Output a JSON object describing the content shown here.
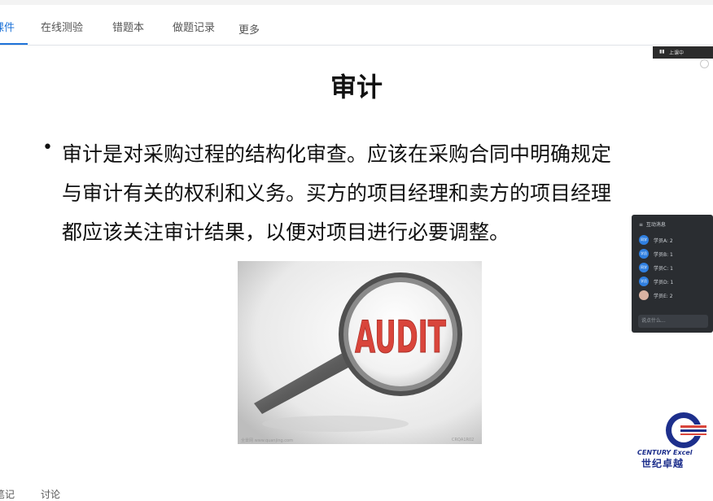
{
  "tabs": [
    {
      "label": "课件",
      "active": true
    },
    {
      "label": "在线测验",
      "active": false
    },
    {
      "label": "错题本",
      "active": false
    },
    {
      "label": "做题记录",
      "active": false
    },
    {
      "label": "更多",
      "active": false
    }
  ],
  "slide": {
    "title": "审计",
    "bullet_char": "•",
    "lines": [
      "审计是对采购过程的结构化审查。应该在采购合同中明确规定",
      "与审计有关的权利和义务。买方的项目经理和卖方的项目经理",
      "都应该关注审计结果，以便对项目进行必要调整。"
    ],
    "image_text": "AUDIT",
    "caption_left": "全景网 www.quanjing.com",
    "caption_right": "CRQA1R02"
  },
  "live": {
    "label": "上课中"
  },
  "chat": {
    "header": "互动消息",
    "messages": [
      {
        "avatar": "同学",
        "name": "学员A: 2"
      },
      {
        "avatar": "学员",
        "name": "学员B: 1"
      },
      {
        "avatar": "同学",
        "name": "学员C: 1"
      },
      {
        "avatar": "学员",
        "name": "学员D: 1"
      },
      {
        "avatar": "",
        "name": "学员E: 2"
      }
    ],
    "input_placeholder": "说点什么..."
  },
  "logo": {
    "en": "CENTURY Excel",
    "cn": "世纪卓越"
  },
  "bottom_tabs": [
    "笔记",
    "讨论"
  ],
  "colors": {
    "accent": "#1e73d8",
    "chat_bg": "#2a2d31",
    "logo_blue": "#1d2f8c",
    "audit_red": "#d9453b"
  }
}
